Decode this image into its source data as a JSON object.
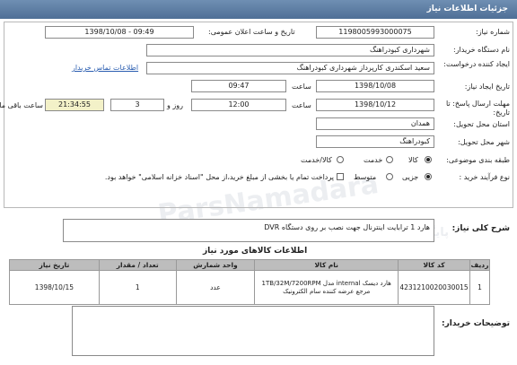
{
  "header": {
    "title": "جزئیات اطلاعات نیاز"
  },
  "form": {
    "need_number_label": "شماره نیاز:",
    "need_number": "1198005993000075",
    "announce_label": "تاریخ و ساعت اعلان عمومی:",
    "announce_value": "1398/10/08 - 09:49",
    "buyer_org_label": "نام دستگاه خریدار:",
    "buyer_org": "شهرداری کبودراهنگ",
    "creator_label": "ایجاد کننده درخواست:",
    "creator": "سعید اسکندری کارپرداز شهرداری کبودراهنگ",
    "contact_link": "اطلاعات تماس خریدار",
    "create_date_label": "تاریخ ایجاد نیاز:",
    "create_date": "1398/10/08",
    "time_label": "ساعت",
    "create_time": "09:47",
    "deadline_label": "مهلت ارسال پاسخ: تا تاریخ:",
    "deadline_date": "1398/10/12",
    "deadline_time": "12:00",
    "day_label": "روز و",
    "days_left": "3",
    "remaining_time": "21:34:55",
    "remaining_label": "ساعت باقی مانده",
    "province_label": "استان محل تحویل:",
    "province": "همدان",
    "city_label": "شهر محل تحویل:",
    "city": "کبودراهنگ",
    "category_label": "طبقه بندی موضوعی:",
    "category_options": [
      "کالا",
      "خدمت",
      "کالا/خدمت"
    ],
    "purchase_type_label": "نوع فرآیند خرید :",
    "purchase_options": [
      "جزیی",
      "متوسط"
    ],
    "payment_note": "پرداخت تمام یا بخشی از مبلغ خرید،از محل \"اسناد خزانه اسلامی\" خواهد بود."
  },
  "summary": {
    "label": "شرح کلی نیاز:",
    "value": "هارد 1 ترابایت اینترنال جهت نصب بر روی دستگاه DVR"
  },
  "items_section": {
    "title": "اطلاعات کالاهای مورد نیاز",
    "columns": [
      "ردیف",
      "کد کالا",
      "نام کالا",
      "واحد شمارش",
      "تعداد / مقدار",
      "تاریخ نیاز"
    ],
    "rows": [
      {
        "row": "1",
        "code": "4231210020030015",
        "name": "هارد دیسک internal مدل 1TB/32M/7200RPM مرجع عرضه کننده سام الکترونیک",
        "unit": "عدد",
        "qty": "1",
        "date": "1398/10/15"
      }
    ]
  },
  "buyer_notes": {
    "label": "توضیحات خریدار:",
    "value": ""
  },
  "watermark": {
    "line1": "ParsNamadara",
    "line2": "پایگاه اطلاع رسانی مناقصه و مزایده پارس نماد داده ها"
  }
}
